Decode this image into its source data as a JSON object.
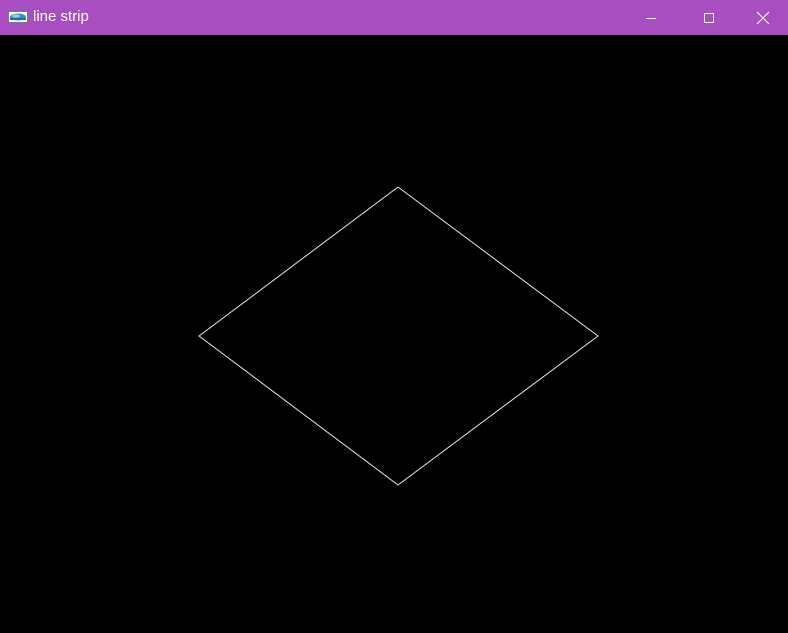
{
  "window": {
    "title": "line strip",
    "titlebar_color": "#a94ec1",
    "app_icon": "opengl-app-icon",
    "controls": {
      "minimize_icon": "minimize-icon",
      "maximize_icon": "maximize-icon",
      "close_icon": "close-icon"
    }
  },
  "canvas": {
    "background_color": "#000000",
    "line_color": "#e6e6e6",
    "shape": "line-strip-diamond"
  }
}
